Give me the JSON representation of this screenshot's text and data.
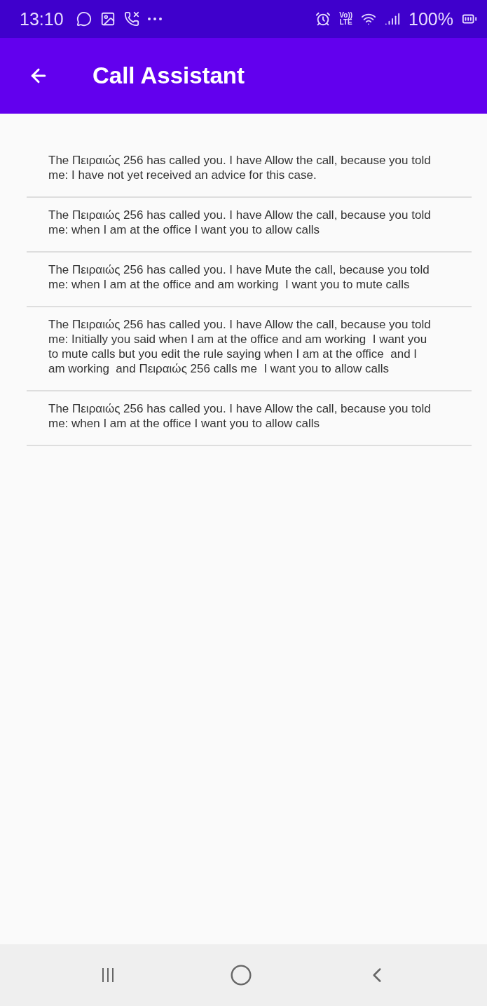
{
  "status_bar": {
    "time": "13:10",
    "volte": [
      "Vo))",
      "LTE"
    ],
    "battery": "100%"
  },
  "app_bar": {
    "title": "Call Assistant"
  },
  "messages": [
    {
      "text": "The Πειραιώς 256 has called you. I have Allow the call, because you told me: I have not yet received an advice for this case."
    },
    {
      "text": "The Πειραιώς 256 has called you. I have Allow the call, because you told me: when I am at the office I want you to allow calls"
    },
    {
      "text": "The Πειραιώς 256 has called you. I have Mute the call, because you told me: when I am at the office and am working  I want you to mute calls"
    },
    {
      "text": "The Πειραιώς 256 has called you. I have Allow the call, because you told me: Initially you said when I am at the office and am working  I want you to mute calls but you edit the rule saying when I am at the office  and I am working  and Πειραιώς 256 calls me  I want you to allow calls"
    },
    {
      "text": "The Πειραιώς 256 has called you. I have Allow the call, because you told me: when I am at the office I want you to allow calls"
    }
  ]
}
